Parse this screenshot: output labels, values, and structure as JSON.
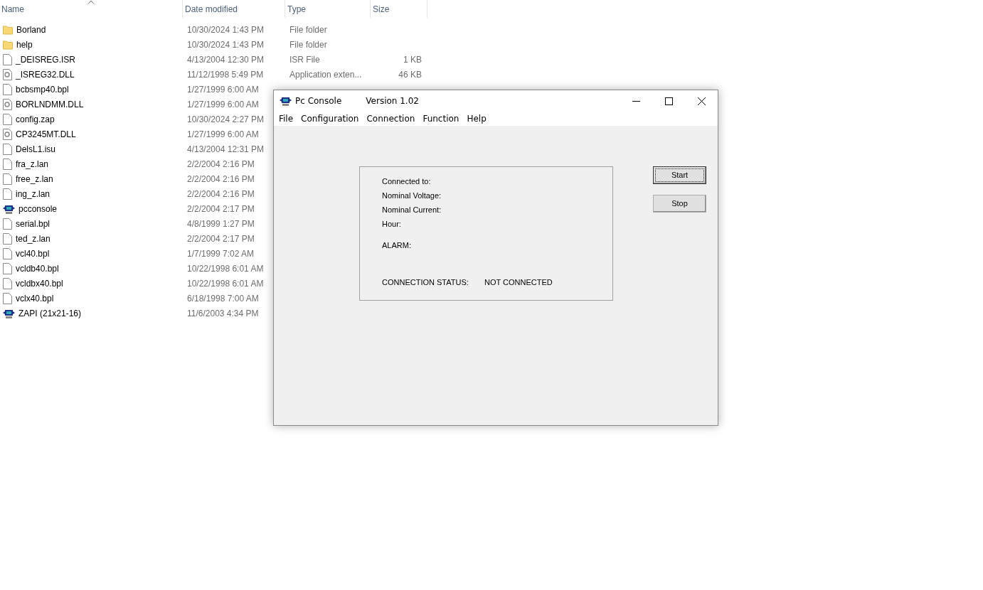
{
  "columns": [
    {
      "label": "Name",
      "sorted": true
    },
    {
      "label": "Date modified",
      "sorted": false
    },
    {
      "label": "Type",
      "sorted": false
    },
    {
      "label": "Size",
      "sorted": false
    }
  ],
  "files": [
    {
      "name": "Borland",
      "date": "10/30/2024 1:43 PM",
      "type": "File folder",
      "kind": "folder"
    },
    {
      "name": "help",
      "date": "10/30/2024 1:43 PM",
      "type": "File folder",
      "kind": "folder"
    },
    {
      "name": "_DEISREG.ISR",
      "date": "4/13/2004 12:30 PM",
      "type": "ISR File",
      "size": "1 KB",
      "kind": "file"
    },
    {
      "name": "_ISREG32.DLL",
      "date": "11/12/1998 5:49 PM",
      "type": "Application exten...",
      "size": "46 KB",
      "kind": "dll"
    },
    {
      "name": "bcbsmp40.bpl",
      "date": "1/27/1999 6:00 AM",
      "kind": "file"
    },
    {
      "name": "BORLNDMM.DLL",
      "date": "1/27/1999 6:00 AM",
      "kind": "dll"
    },
    {
      "name": "config.zap",
      "date": "10/30/2024 2:27 PM",
      "kind": "file"
    },
    {
      "name": "CP3245MT.DLL",
      "date": "1/27/1999 6:00 AM",
      "kind": "dll"
    },
    {
      "name": "DelsL1.isu",
      "date": "4/13/2004 12:31 PM",
      "kind": "file"
    },
    {
      "name": "fra_z.lan",
      "date": "2/2/2004 2:16 PM",
      "kind": "file"
    },
    {
      "name": "free_z.lan",
      "date": "2/2/2004 2:16 PM",
      "kind": "file"
    },
    {
      "name": "ing_z.lan",
      "date": "2/2/2004 2:16 PM",
      "kind": "file"
    },
    {
      "name": "pcconsole",
      "date": "2/2/2004 2:17 PM",
      "kind": "app"
    },
    {
      "name": "serial.bpl",
      "date": "4/8/1999 1:27 PM",
      "kind": "file"
    },
    {
      "name": "ted_z.lan",
      "date": "2/2/2004 2:17 PM",
      "kind": "file"
    },
    {
      "name": "vcl40.bpl",
      "date": "1/7/1999 7:02 AM",
      "kind": "file"
    },
    {
      "name": "vcldb40.bpl",
      "date": "10/22/1998 6:01 AM",
      "kind": "file"
    },
    {
      "name": "vcldbx40.bpl",
      "date": "10/22/1998 6:01 AM",
      "kind": "file"
    },
    {
      "name": "vclx40.bpl",
      "date": "6/18/1998 7:00 AM",
      "kind": "file"
    },
    {
      "name": "ZAPI (21x21-16)",
      "date": "11/6/2003 4:34 PM",
      "kind": "app"
    }
  ],
  "window": {
    "title": "Pc Console",
    "version": "Version 1.02"
  },
  "menu": [
    "File",
    "Configuration",
    "Connection",
    "Function",
    "Help"
  ],
  "info_fields": [
    "Connected to:",
    "Nominal Voltage:",
    "Nominal Current:",
    "Hour:"
  ],
  "alarm_label": "ALARM:",
  "status": {
    "label": "CONNECTION STATUS:",
    "value": "NOT CONNECTED"
  },
  "buttons": [
    {
      "label": "Start",
      "focused": true
    },
    {
      "label": "Stop",
      "focused": false
    }
  ]
}
